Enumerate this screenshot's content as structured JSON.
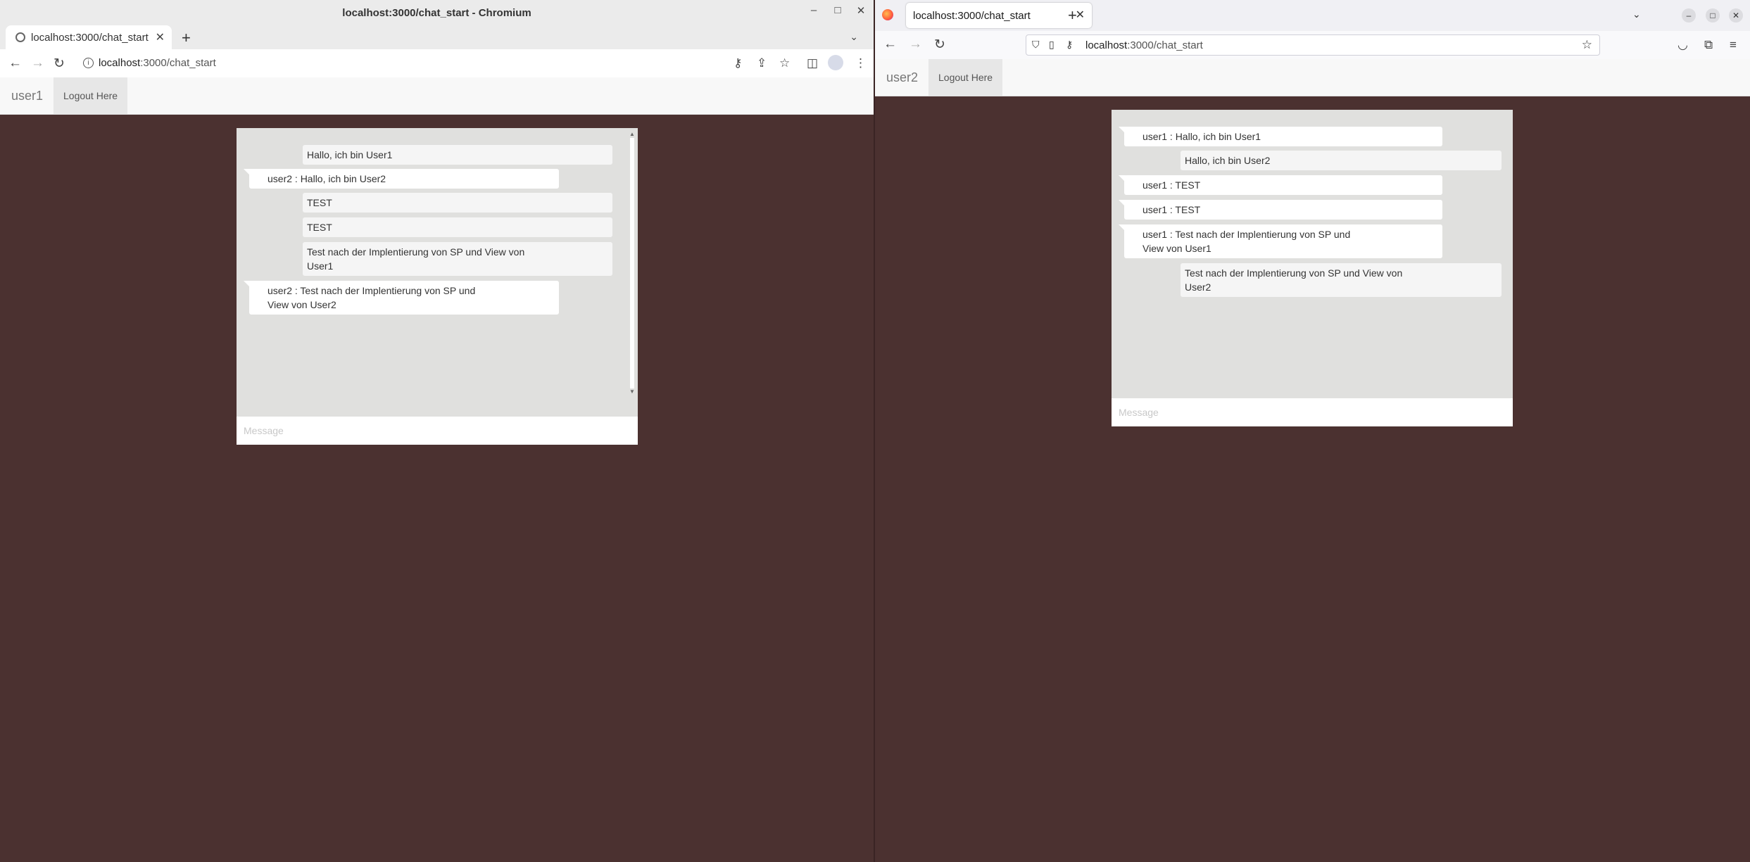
{
  "left_window": {
    "title": "localhost:3000/chat_start - Chromium",
    "tab_title": "localhost:3000/chat_start",
    "url_host": "localhost",
    "url_rest": ":3000/chat_start",
    "app": {
      "username": "user1",
      "logout_label": "Logout Here",
      "input_placeholder": "Message",
      "messages": [
        {
          "sender": "self",
          "text": "Hallo, ich bin User1"
        },
        {
          "sender": "other",
          "text": "user2 : Hallo, ich bin User2"
        },
        {
          "sender": "self",
          "text": "TEST"
        },
        {
          "sender": "self",
          "text": "TEST"
        },
        {
          "sender": "self",
          "text": "Test nach der Implentierung von SP und View von User1"
        },
        {
          "sender": "other",
          "text": "user2 : Test nach der Implentierung von SP und View von User2"
        }
      ]
    }
  },
  "right_window": {
    "tab_title": "localhost:3000/chat_start",
    "url_host": "localhost",
    "url_rest": ":3000/chat_start",
    "app": {
      "username": "user2",
      "logout_label": "Logout Here",
      "input_placeholder": "Message",
      "messages": [
        {
          "sender": "other",
          "text": "user1 : Hallo, ich bin User1"
        },
        {
          "sender": "self",
          "text": "Hallo, ich bin User2"
        },
        {
          "sender": "other",
          "text": "user1 : TEST"
        },
        {
          "sender": "other",
          "text": "user1 : TEST"
        },
        {
          "sender": "other",
          "text": "user1 : Test nach der Implentierung von SP und View von User1"
        },
        {
          "sender": "self",
          "text": "Test nach der Implentierung von SP und View von User2"
        }
      ]
    }
  },
  "colors": {
    "page_background": "#4b3130",
    "chat_background": "#e0e0de",
    "navbar_background": "#f8f8f8"
  },
  "icons": [
    "back-icon",
    "forward-icon",
    "reload-icon",
    "info-icon",
    "key-icon",
    "share-icon",
    "star-icon",
    "sidepanel-icon",
    "profile-icon",
    "menu-icon",
    "shield-icon",
    "page-icon",
    "pocket-icon",
    "extensions-icon",
    "firefox-logo-icon"
  ]
}
